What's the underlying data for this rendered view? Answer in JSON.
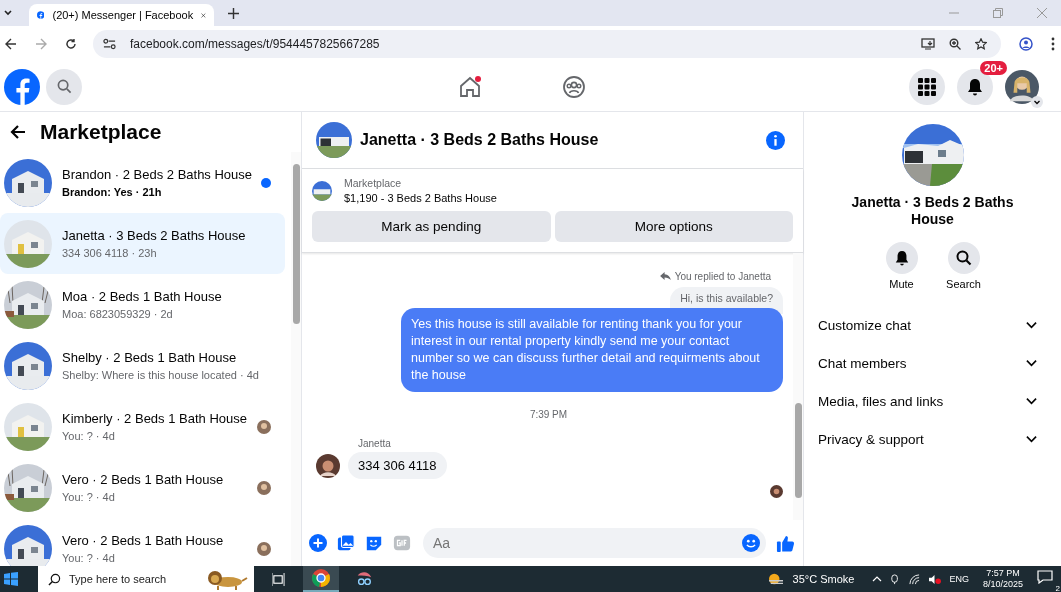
{
  "browser": {
    "tab_title": "(20+) Messenger | Facebook",
    "url": "facebook.com/messages/t/9544457825667285"
  },
  "header": {
    "notification_badge": "20+"
  },
  "sidebar": {
    "title": "Marketplace",
    "conversations": [
      {
        "title": "Brandon · 2 Beds 2 Baths House",
        "snippet": "Brandon: Yes · 21h",
        "selected": false,
        "unread": true,
        "seen": false
      },
      {
        "title": "Janetta · 3 Beds 2 Baths House",
        "snippet": "334 306 4118 · 23h",
        "selected": true,
        "unread": false,
        "seen": false
      },
      {
        "title": "Moa · 2 Beds 1 Bath House",
        "snippet": "Moa: 6823059329 · 2d",
        "selected": false,
        "unread": false,
        "seen": false
      },
      {
        "title": "Shelby · 2 Beds 1 Bath House",
        "snippet": "Shelby: Where is this house located · 4d",
        "selected": false,
        "unread": false,
        "seen": false
      },
      {
        "title": "Kimberly · 2 Beds 1 Bath House",
        "snippet": "You: ? · 4d",
        "selected": false,
        "unread": false,
        "seen": true
      },
      {
        "title": "Vero · 2 Beds 1 Bath House",
        "snippet": "You: ? · 4d",
        "selected": false,
        "unread": false,
        "seen": true
      },
      {
        "title": "Vero · 2 Beds 1 Bath House",
        "snippet": "You: ? · 4d",
        "selected": false,
        "unread": false,
        "seen": true
      }
    ]
  },
  "chat": {
    "title": "Janetta · 3 Beds 2 Baths House",
    "listing": {
      "label": "Marketplace",
      "text": "$1,190 - 3 Beds 2 Baths House"
    },
    "buttons": [
      "Mark as pending",
      "More options"
    ],
    "messages": [
      {
        "kind": "reply_note",
        "text": "You replied to Janetta"
      },
      {
        "kind": "quoted",
        "text": "Hi, is this available?"
      },
      {
        "kind": "outgoing",
        "text": "Yes this house is still available for renting thank you for your interest in our rental property kindly send me your contact number so we can discuss further detail and requirments about the house"
      },
      {
        "kind": "timestamp",
        "text": "7:39 PM"
      },
      {
        "kind": "sender",
        "text": "Janetta"
      },
      {
        "kind": "incoming",
        "text": "334 306 4118"
      }
    ],
    "composer": {
      "placeholder": "Aa"
    }
  },
  "details": {
    "title": "Janetta · 3 Beds 2 Baths House",
    "actions": [
      {
        "kind": "mute",
        "label": "Mute"
      },
      {
        "kind": "search",
        "label": "Search"
      }
    ],
    "sections": [
      {
        "label": "Customize chat",
        "expanded": false
      },
      {
        "label": "Chat members",
        "expanded": false
      },
      {
        "label": "Media, files and links",
        "expanded": false
      },
      {
        "label": "Privacy & support",
        "expanded": false
      }
    ]
  },
  "taskbar": {
    "search_placeholder": "Type here to search",
    "weather": "35°C Smoke",
    "language": "ENG",
    "time": "7:57 PM",
    "date": "8/10/2025",
    "notifications": "2"
  }
}
